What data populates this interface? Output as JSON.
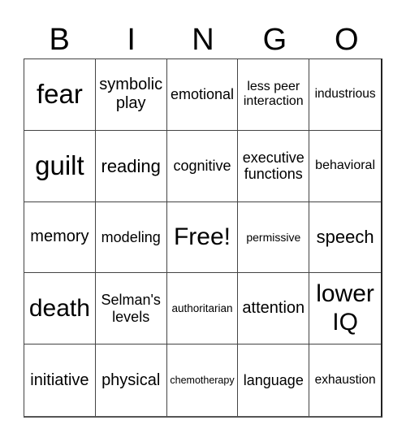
{
  "header": {
    "letters": [
      "B",
      "I",
      "N",
      "G",
      "O"
    ]
  },
  "cells": [
    "fear",
    "symbolic play",
    "emotional",
    "less peer interaction",
    "industrious",
    "guilt",
    "reading",
    "cognitive",
    "executive functions",
    "behavioral",
    "memory",
    "modeling",
    "Free!",
    "permissive",
    "speech",
    "death",
    "Selman's levels",
    "authoritarian",
    "attention",
    "lower IQ",
    "initiative",
    "physical",
    "chemotherapy",
    "language",
    "exhaustion"
  ]
}
